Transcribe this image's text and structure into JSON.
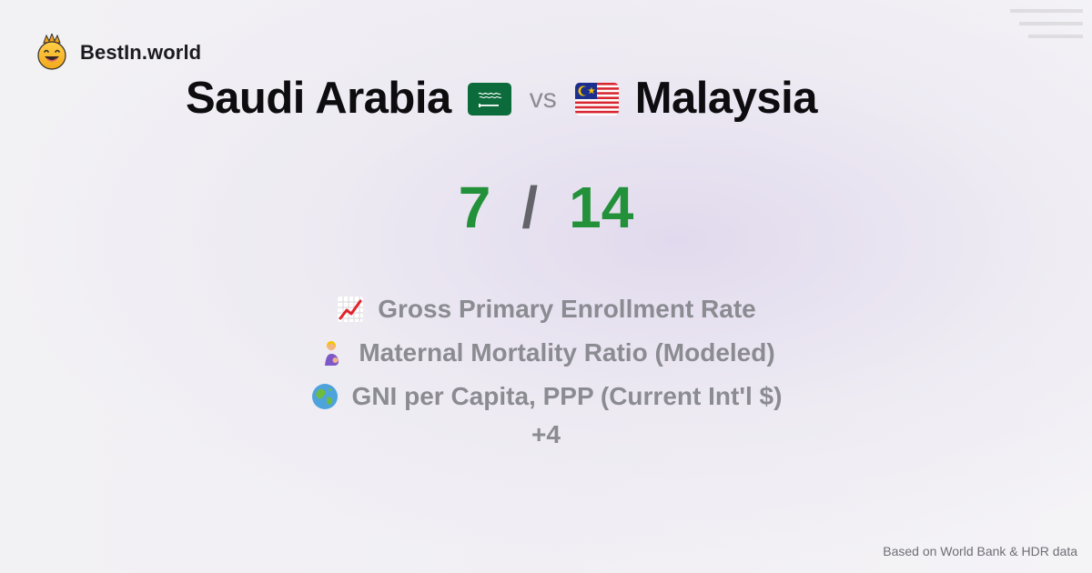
{
  "brand": {
    "name": "BestIn.world",
    "logo_icon": "crowned-smiley-icon"
  },
  "comparison": {
    "country_left": "Saudi Arabia",
    "country_left_flag": "saudi-arabia-flag-icon",
    "vs_text": "vs",
    "country_right": "Malaysia",
    "country_right_flag": "malaysia-flag-icon"
  },
  "score": {
    "left": "7",
    "separator": "/",
    "right": "14",
    "accent_color": "#23903a"
  },
  "metrics": [
    {
      "icon": "chart-increasing-icon",
      "label": "Gross Primary Enrollment Rate"
    },
    {
      "icon": "pregnant-woman-icon",
      "label": "Maternal Mortality Ratio (Modeled)"
    },
    {
      "icon": "globe-icon",
      "label": "GNI per Capita, PPP (Current Int'l $)"
    }
  ],
  "more_count": "+4",
  "footer": {
    "source": "Based on World Bank & HDR data"
  }
}
